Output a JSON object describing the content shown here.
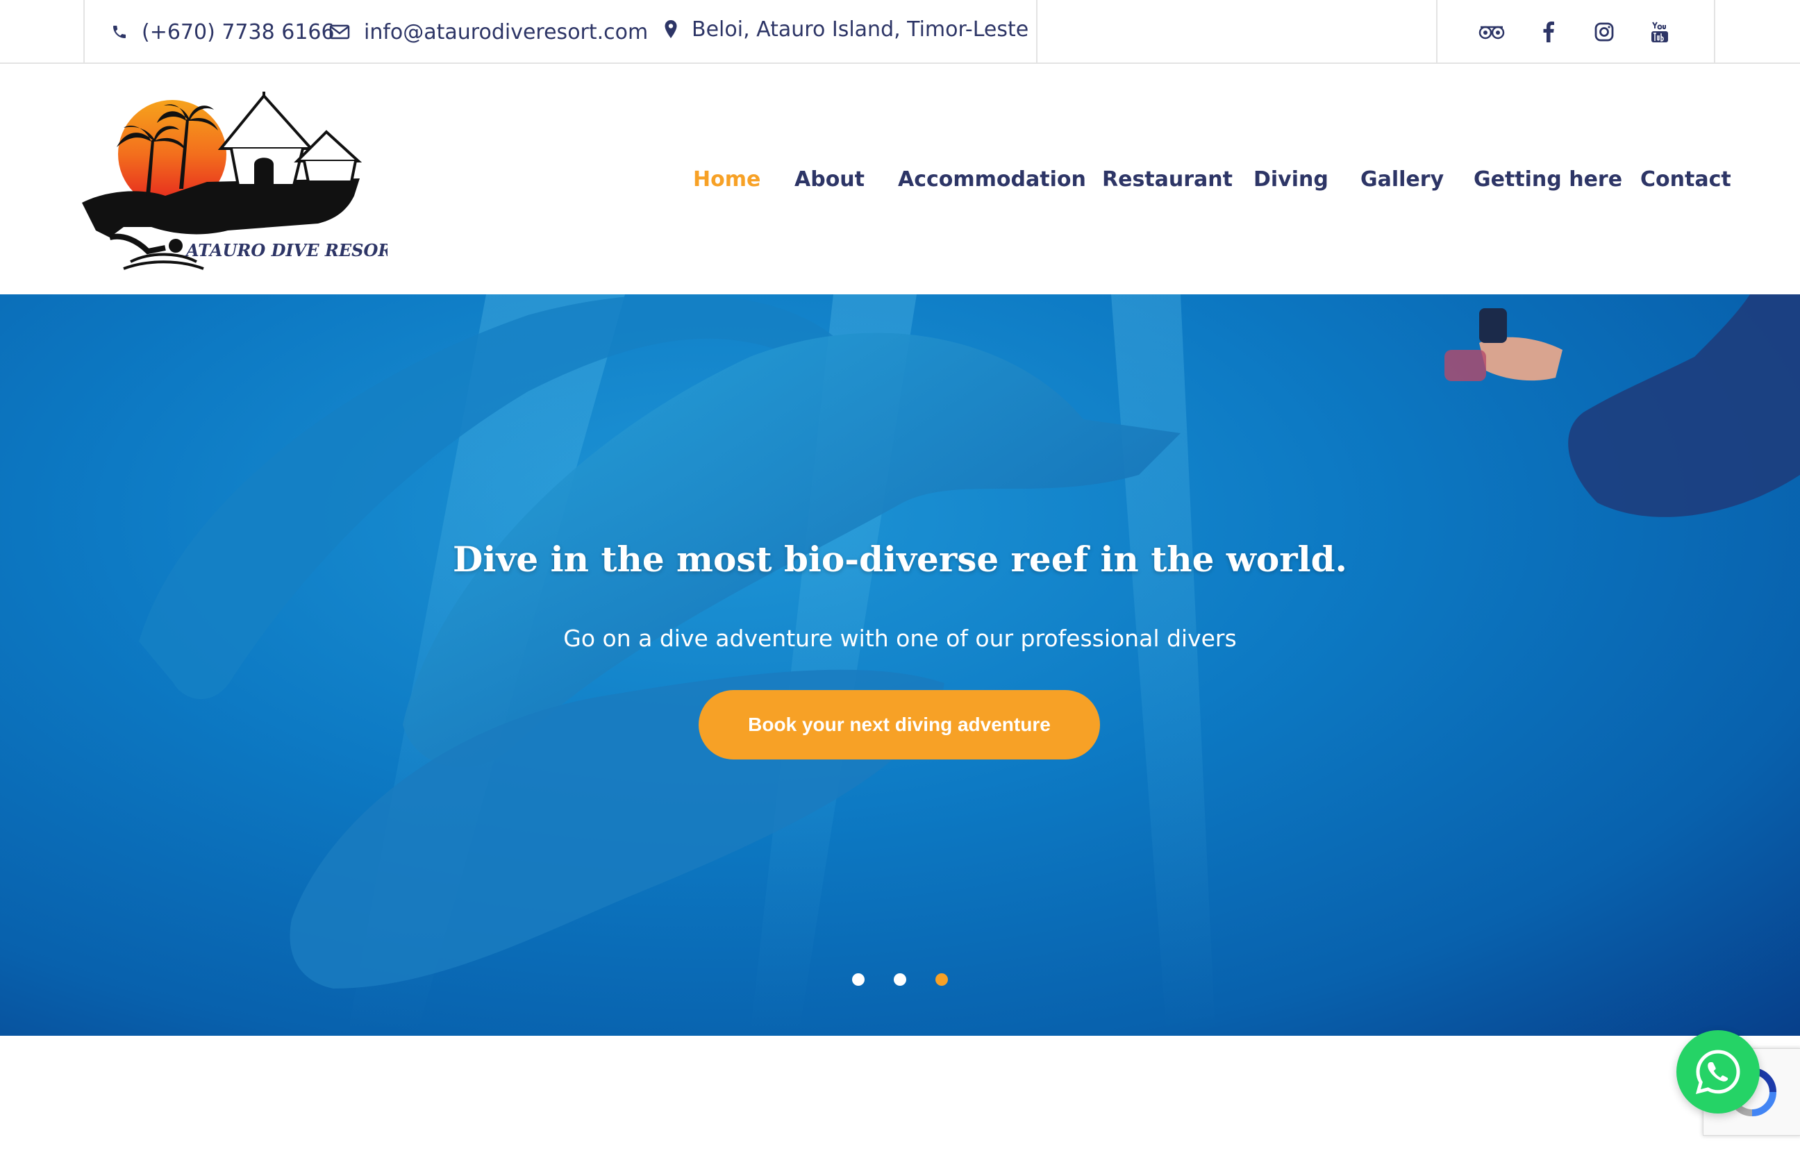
{
  "topbar": {
    "phone": "(+670) 7738 6166",
    "email": "info@ataurodiveresort.com",
    "location": "Beloi, Atauro Island, Timor-Leste",
    "social_icons": [
      "tripadvisor-icon",
      "facebook-icon",
      "instagram-icon",
      "youtube-icon"
    ]
  },
  "logo": {
    "text": "ATAURO DIVE RESORT"
  },
  "nav": {
    "items": [
      {
        "label": "Home",
        "active": true
      },
      {
        "label": "About"
      },
      {
        "label": "Accommodation"
      },
      {
        "label": "Restaurant"
      },
      {
        "label": "Diving"
      },
      {
        "label": "Gallery"
      },
      {
        "label": "Getting here"
      },
      {
        "label": "Contact"
      }
    ]
  },
  "hero": {
    "title": "Dive in the most bio-diverse reef in the world.",
    "subtitle": "Go on a dive adventure with one of our professional divers",
    "button_label": "Book your next diving adventure",
    "slides": 3,
    "active_slide": 3
  },
  "colors": {
    "accent": "#f7a126",
    "nav_text": "#2d3566",
    "whatsapp": "#25d366"
  }
}
